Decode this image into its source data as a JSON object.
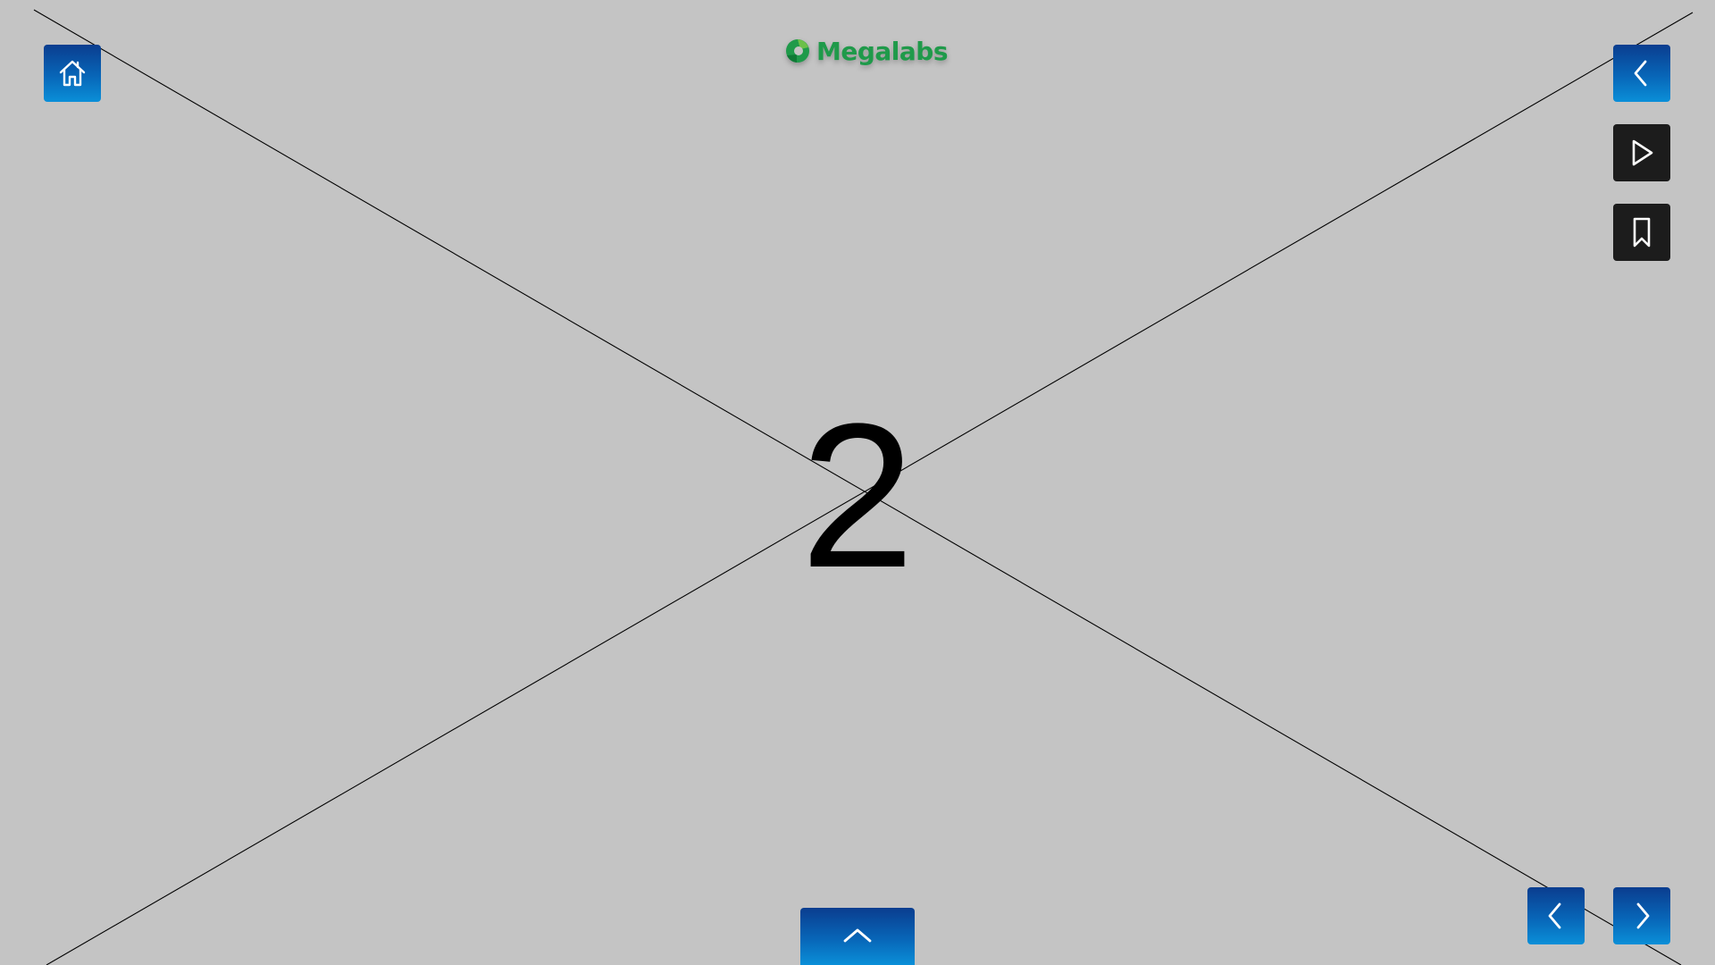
{
  "brand": {
    "name": "Megalabs",
    "color": "#1f9a4a"
  },
  "slide": {
    "number": "2",
    "placeholder_background": "#c4c4c4"
  },
  "toolbar": {
    "home_icon": "home-icon",
    "back_icon": "chevron-left-icon",
    "play_icon": "play-icon",
    "bookmark_icon": "bookmark-icon",
    "prev_icon": "chevron-left-icon",
    "next_icon": "chevron-right-icon",
    "up_icon": "chevron-up-icon",
    "accent_color": "#0866b8",
    "dark_color": "#1c1c1c"
  }
}
